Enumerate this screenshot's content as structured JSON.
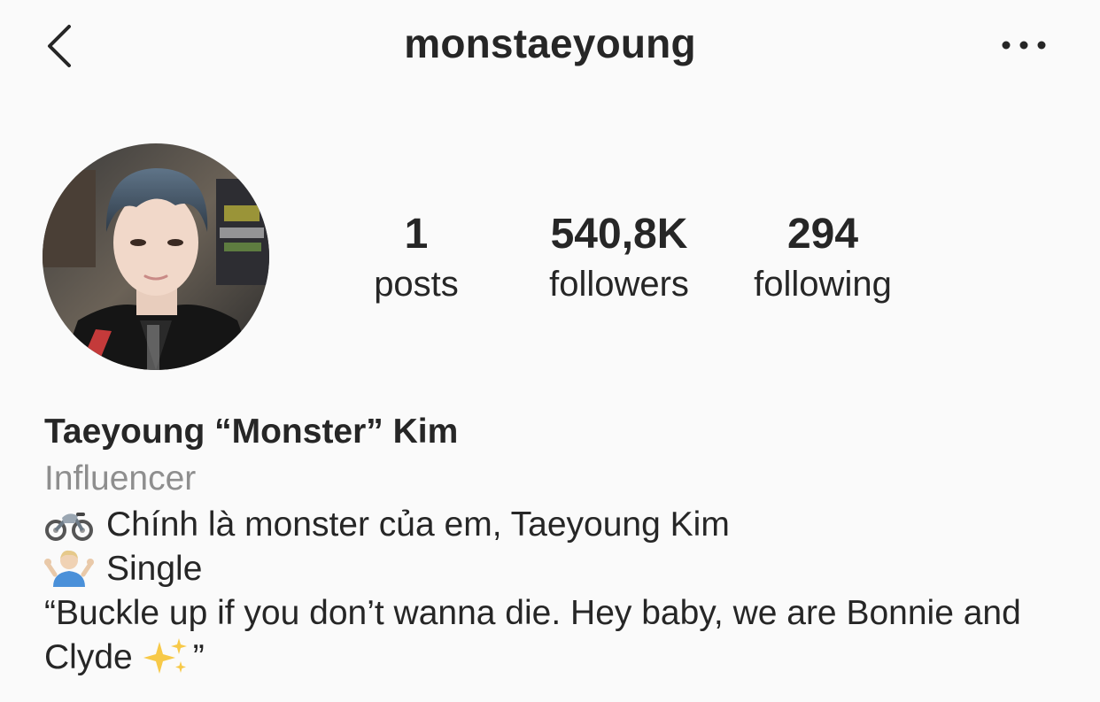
{
  "header": {
    "back_icon": "chevron-left-icon",
    "username": "monstaeyoung",
    "more_icon": "more-horizontal-icon"
  },
  "profile": {
    "avatar_alt": "profile photo",
    "stats": {
      "posts": {
        "value": "1",
        "label": "posts"
      },
      "followers": {
        "value": "540,8K",
        "label": "followers"
      },
      "following": {
        "value": "294",
        "label": "following"
      }
    },
    "display_name": "Taeyoung “Monster” Kim",
    "category": "Influencer",
    "bio": {
      "line1_icon": "motorcycle-icon",
      "line1_text": "Chính là monster của em, Taeyoung Kim",
      "line2_icon": "shrugging-person-icon",
      "line2_text": "Single",
      "quote_text": "“Buckle up if you don’t wanna die. Hey baby, we are Bonnie and Clyde",
      "quote_icon": "sparkles-icon",
      "quote_end": "”"
    }
  },
  "colors": {
    "background": "#fafafa",
    "text": "#262626",
    "secondary_text": "#8e8e8e"
  }
}
